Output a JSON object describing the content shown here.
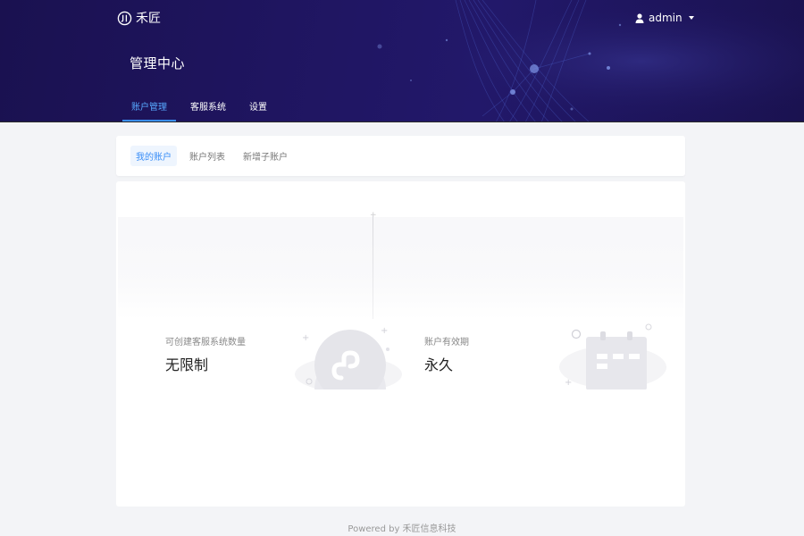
{
  "brand": {
    "name": "禾匠"
  },
  "user": {
    "name": "admin"
  },
  "header": {
    "title": "管理中心"
  },
  "nav": {
    "items": [
      {
        "label": "账户管理",
        "active": true
      },
      {
        "label": "客服系统",
        "active": false
      },
      {
        "label": "设置",
        "active": false
      }
    ]
  },
  "tabs": {
    "items": [
      {
        "label": "我的账户",
        "active": true
      },
      {
        "label": "账户列表",
        "active": false
      },
      {
        "label": "新增子账户",
        "active": false
      }
    ]
  },
  "stats": [
    {
      "label": "可创建客服系统数量",
      "value": "无限制",
      "icon": "mini-program-icon"
    },
    {
      "label": "账户有效期",
      "value": "永久",
      "icon": "calendar-icon"
    }
  ],
  "footer": {
    "text": "Powered by 禾匠信息科技"
  },
  "colors": {
    "header_bg": "#1f1560",
    "accent": "#3a8ef7",
    "page_bg": "#f3f4f7"
  }
}
